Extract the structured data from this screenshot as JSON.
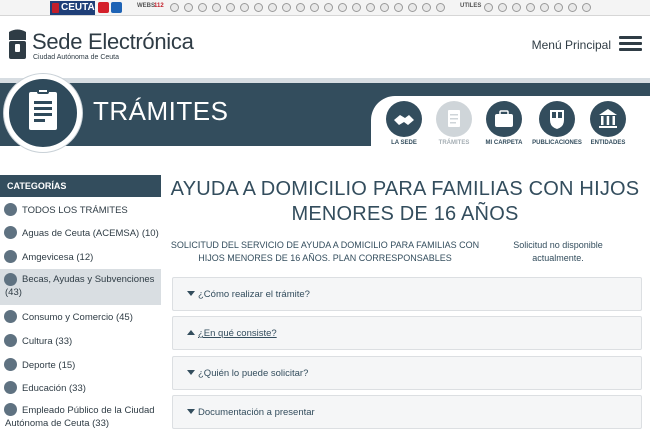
{
  "portal_bar": {
    "brand": "CEUTA",
    "labels": [
      "WEBS",
      "UTILES"
    ],
    "number_badge": "112"
  },
  "header": {
    "title": "Sede Electrónica",
    "subtitle": "Ciudad Autónoma de Ceuta",
    "menu_label": "Menú Principal"
  },
  "banner": {
    "title": "TRÁMITES",
    "nav": [
      {
        "label": "LA SEDE",
        "icon": "handshake-icon"
      },
      {
        "label": "TRÁMITES",
        "icon": "document-icon",
        "active": true
      },
      {
        "label": "MI CARPETA",
        "icon": "briefcase-icon"
      },
      {
        "label": "PUBLICACIONES",
        "icon": "crest-icon"
      },
      {
        "label": "ENTIDADES",
        "icon": "building-icon"
      }
    ]
  },
  "sidebar": {
    "heading": "CATEGORÍAS",
    "items": [
      {
        "label": "TODOS LOS TRÁMITES",
        "icon": "list-icon"
      },
      {
        "label": "Aguas de Ceuta (ACEMSA) (10)",
        "icon": "water-icon"
      },
      {
        "label": "Amgevicesa (12)",
        "icon": "house-icon"
      },
      {
        "label": "Becas, Ayudas y Subvenciones (43)",
        "icon": "coins-icon",
        "selected": true
      },
      {
        "label": "Consumo y Comercio (45)",
        "icon": "euro-icon"
      },
      {
        "label": "Cultura (33)",
        "icon": "culture-icon"
      },
      {
        "label": "Deporte (15)",
        "icon": "sport-icon"
      },
      {
        "label": "Educación (33)",
        "icon": "education-icon"
      },
      {
        "label": "Empleado Público de la Ciudad Autónoma de Ceuta (33)",
        "icon": "employee-icon"
      }
    ]
  },
  "main": {
    "title": "AYUDA A DOMICILIO PARA FAMILIAS CON HIJOS MENORES DE 16 AÑOS",
    "description": "SOLICITUD DEL SERVICIO DE AYUDA A DOMICILIO PARA FAMILIAS CON HIJOS MENORES DE 16 AÑOS. PLAN CORRESPONSABLES",
    "status": "Solicitud no disponible actualmente.",
    "accordion": [
      {
        "label": "¿Cómo realizar el trámite?",
        "expanded": false
      },
      {
        "label": "¿En qué consiste?",
        "expanded": true
      },
      {
        "label": "¿Quién lo puede solicitar?",
        "expanded": false
      },
      {
        "label": "Documentación a presentar",
        "expanded": false
      }
    ]
  },
  "colors": {
    "primary": "#334d5d",
    "sidebar_selected": "#d9dee2",
    "text": "#2f3c45"
  }
}
